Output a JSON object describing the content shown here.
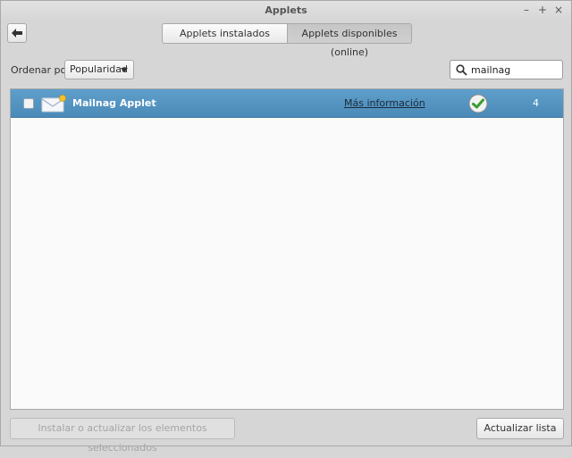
{
  "window": {
    "title": "Applets",
    "minimize": "–",
    "maximize": "+",
    "close": "×"
  },
  "tabs": [
    {
      "label": "Applets instalados",
      "active": false
    },
    {
      "label": "Applets disponibles (online)",
      "active": true
    }
  ],
  "sort": {
    "label": "Ordenar por",
    "selected": "Popularidad"
  },
  "search": {
    "value": "mailnag",
    "placeholder": ""
  },
  "list": {
    "rows": [
      {
        "name": "Mailnag Applet",
        "more_info": "Más información",
        "installed": true,
        "score": "4",
        "checked": false,
        "icon": "mail-icon"
      }
    ]
  },
  "footer": {
    "install_label": "Instalar o actualizar los elementos seleccionados",
    "refresh_label": "Actualizar lista"
  },
  "colors": {
    "selection": "#4b8ab8",
    "ok_green": "#3a9d2f"
  }
}
